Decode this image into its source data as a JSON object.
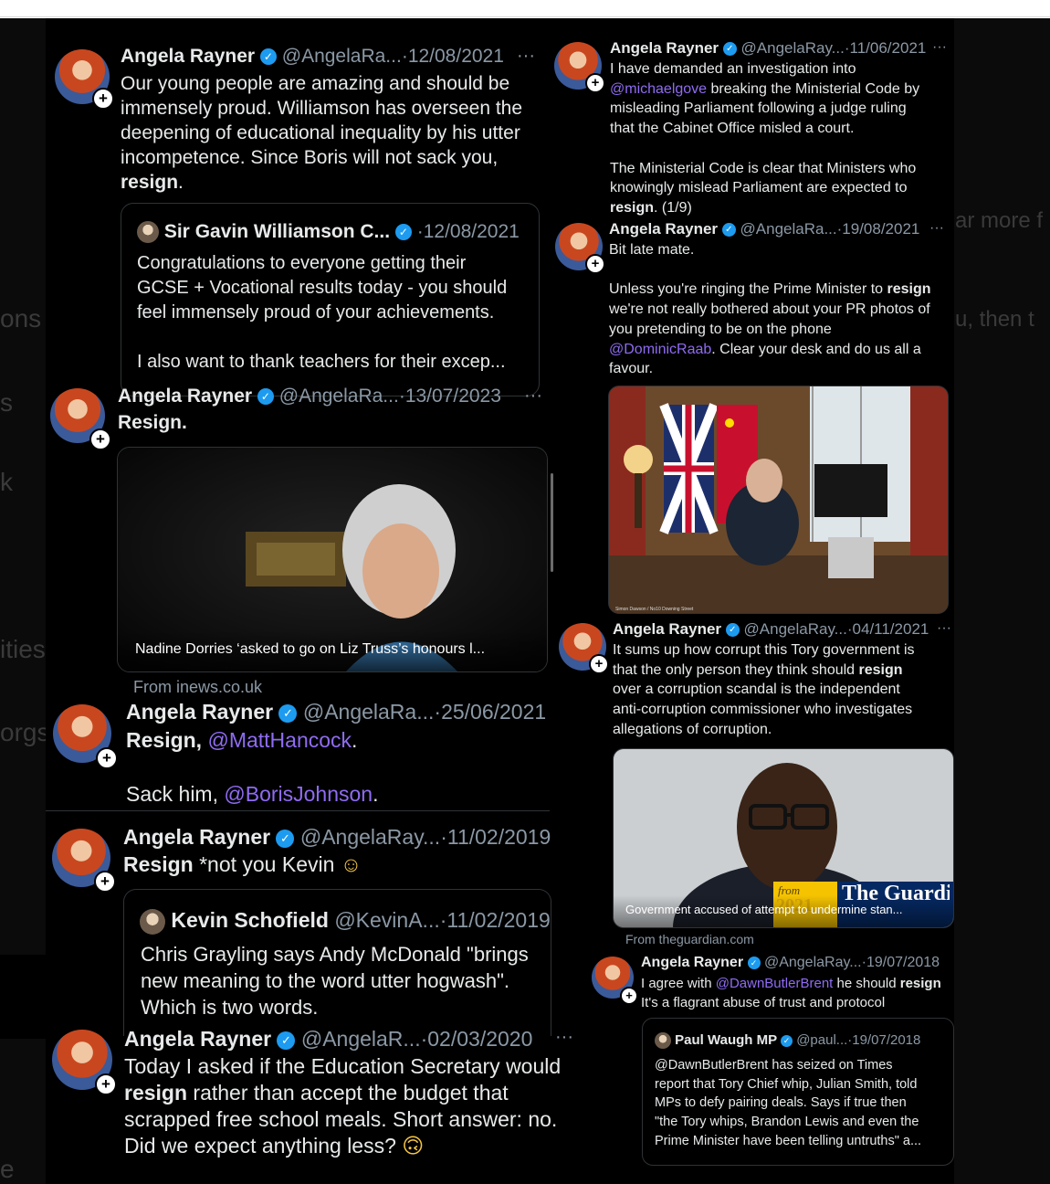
{
  "background_fragments": [
    "ons",
    "s",
    "k",
    "ities",
    "orgs",
    "e",
    "ar more f",
    "u, then t"
  ],
  "left": {
    "tweet1": {
      "name": "Angela Rayner",
      "handle": "@AngelaRa...",
      "date": "12/08/2021",
      "text_lines": [
        "Our young people are amazing and should be",
        "immensely proud. Williamson has overseen the",
        "deepening of educational inequality by his utter",
        "incompetence. Since Boris will not sack you,"
      ],
      "bold_end": "resign",
      "end_punct": "."
    },
    "quote1": {
      "name": "Sir Gavin Williamson C...",
      "date": "12/08/2021",
      "lines": [
        "Congratulations to everyone getting their",
        "GCSE + Vocational results today - you should",
        "feel immensely proud of your achievements."
      ],
      "line_last": "I also want to thank teachers for their excep..."
    },
    "tweet2": {
      "name": "Angela Rayner",
      "handle": "@AngelaRa...",
      "date": "13/07/2023",
      "text": "Resign.",
      "card_caption": "Nadine Dorries ‘asked to go on Liz Truss’s honours l...",
      "from": "From inews.co.uk"
    },
    "tweet3": {
      "name": "Angela Rayner",
      "handle": "@AngelaRa...",
      "date": "25/06/2021",
      "bold": "Resign,",
      "mention1": "@MattHancock",
      "punct1": ".",
      "line2_text": "Sack him, ",
      "mention2": "@BorisJohnson",
      "punct2": "."
    },
    "tweet4": {
      "name": "Angela Rayner",
      "handle": "@AngelaRay...",
      "date": "11/02/2019",
      "bold": "Resign",
      "text": " *not you Kevin",
      "emoji": "☺"
    },
    "quote4": {
      "name": "Kevin Schofield",
      "handle": "@KevinA...",
      "date": "11/02/2019",
      "lines": [
        "Chris Grayling says Andy McDonald \"brings",
        "new meaning to the word utter hogwash\".",
        "Which is two words."
      ]
    },
    "tweet5": {
      "name": "Angela Rayner",
      "handle": "@AngelaR...",
      "date": "02/03/2020",
      "line1": "Today I asked if the Education Secretary would",
      "bold": "resign",
      "line2_rest": " rather than accept the budget that",
      "line3": "scrapped free school meals. Short answer: no.",
      "line4": "Did we expect anything less?",
      "emoji": "🙃"
    }
  },
  "right": {
    "tweet1": {
      "name": "Angela Rayner",
      "handle": "@AngelaRay...",
      "date": "11/06/2021",
      "line1": "I have demanded an investigation into",
      "mention": "@michaelgove",
      "line2_rest": " breaking the Ministerial Code by",
      "line3": "misleading Parliament following a judge ruling",
      "line4": "that the Cabinet Office misled a court.",
      "line5": "The Ministerial Code is clear that Ministers who",
      "line6": "knowingly mislead Parliament are expected to",
      "bold": "resign",
      "line7_rest": ". (1/9)"
    },
    "tweet2": {
      "name": "Angela Rayner",
      "handle": "@AngelaRa...",
      "date": "19/08/2021",
      "line1": "Bit late mate.",
      "line2a": "Unless you're ringing the Prime Minister to ",
      "bold": "resign",
      "line3": "we're not really bothered about your PR photos of",
      "line4": "you pretending to be on the phone",
      "mention": "@DominicRaab",
      "line5_rest": ". Clear your desk and do us all a",
      "line6": "favour.",
      "photo_credit": "Simon Dawson / No10 Downing Street"
    },
    "tweet3": {
      "name": "Angela Rayner",
      "handle": "@AngelaRay...",
      "date": "04/11/2021",
      "line1": "It sums up how corrupt this Tory government is",
      "line2a": "that the only person they think should ",
      "bold": "resign",
      "line3": "over a corruption scandal is the independent",
      "line4": "anti-corruption commissioner who investigates",
      "line5": "allegations of corruption.",
      "card_caption": "Government accused of attempt to undermine stan...",
      "card_logo_from": "from",
      "card_logo_year": "2021",
      "card_logo_name": "The Guardian",
      "from": "From theguardian.com"
    },
    "tweet4": {
      "name": "Angela Rayner",
      "handle": "@AngelaRay...",
      "date": "19/07/2018",
      "line1a": "I agree with ",
      "mention": "@DawnButlerBrent",
      "line1b": " he should ",
      "bold": "resign",
      "line2": "It's a flagrant abuse of trust and protocol"
    },
    "quote4": {
      "name": "Paul Waugh MP",
      "handle": "@paul...",
      "date": "19/07/2018",
      "lines": [
        "@DawnButlerBrent has seized on Times",
        "report that Tory Chief whip, Julian Smith, told",
        "MPs to defy pairing deals. Says if true then",
        "\"the Tory whips, Brandon Lewis and even the",
        "Prime Minister have been telling untruths\" a..."
      ]
    }
  },
  "ui": {
    "more_glyph": "···",
    "dot": "·",
    "plus": "+",
    "verified": "✓"
  }
}
